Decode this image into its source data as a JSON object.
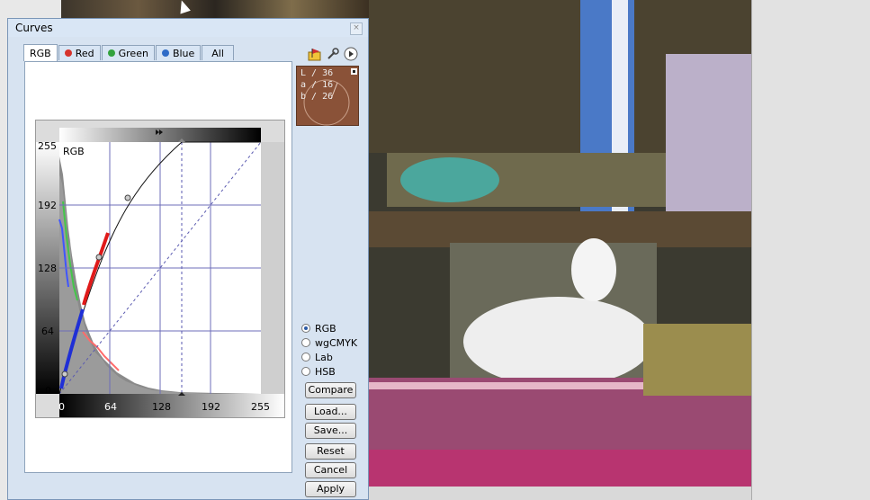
{
  "window": {
    "title": "Curves",
    "close_glyph": "×"
  },
  "tabs": [
    {
      "label": "RGB",
      "active": true,
      "dot": null
    },
    {
      "label": "Red",
      "active": false,
      "dot": "#d6332c"
    },
    {
      "label": "Green",
      "active": false,
      "dot": "#33a23d"
    },
    {
      "label": "Blue",
      "active": false,
      "dot": "#2f6cc7"
    },
    {
      "label": "All",
      "active": false,
      "dot": null
    }
  ],
  "toolbar": {
    "icons": [
      "flag-folder-icon",
      "wrench-icon",
      "play-icon"
    ]
  },
  "lab_readout": {
    "L": "36",
    "a": "16",
    "b": "26",
    "L_label": "L /",
    "a_label": "a /",
    "b_label": "b /"
  },
  "graph": {
    "channel_label": "RGB",
    "y_ticks": [
      "255",
      "192",
      "128",
      "64",
      "0"
    ],
    "x_ticks": [
      "0",
      "64",
      "128",
      "192",
      "255"
    ]
  },
  "color_modes": [
    {
      "label": "RGB",
      "selected": true
    },
    {
      "label": "wgCMYK",
      "selected": false
    },
    {
      "label": "Lab",
      "selected": false
    },
    {
      "label": "HSB",
      "selected": false
    }
  ],
  "buttons": {
    "compare": "Compare",
    "load": "Load...",
    "save": "Save...",
    "reset": "Reset",
    "cancel": "Cancel",
    "apply": "Apply"
  }
}
